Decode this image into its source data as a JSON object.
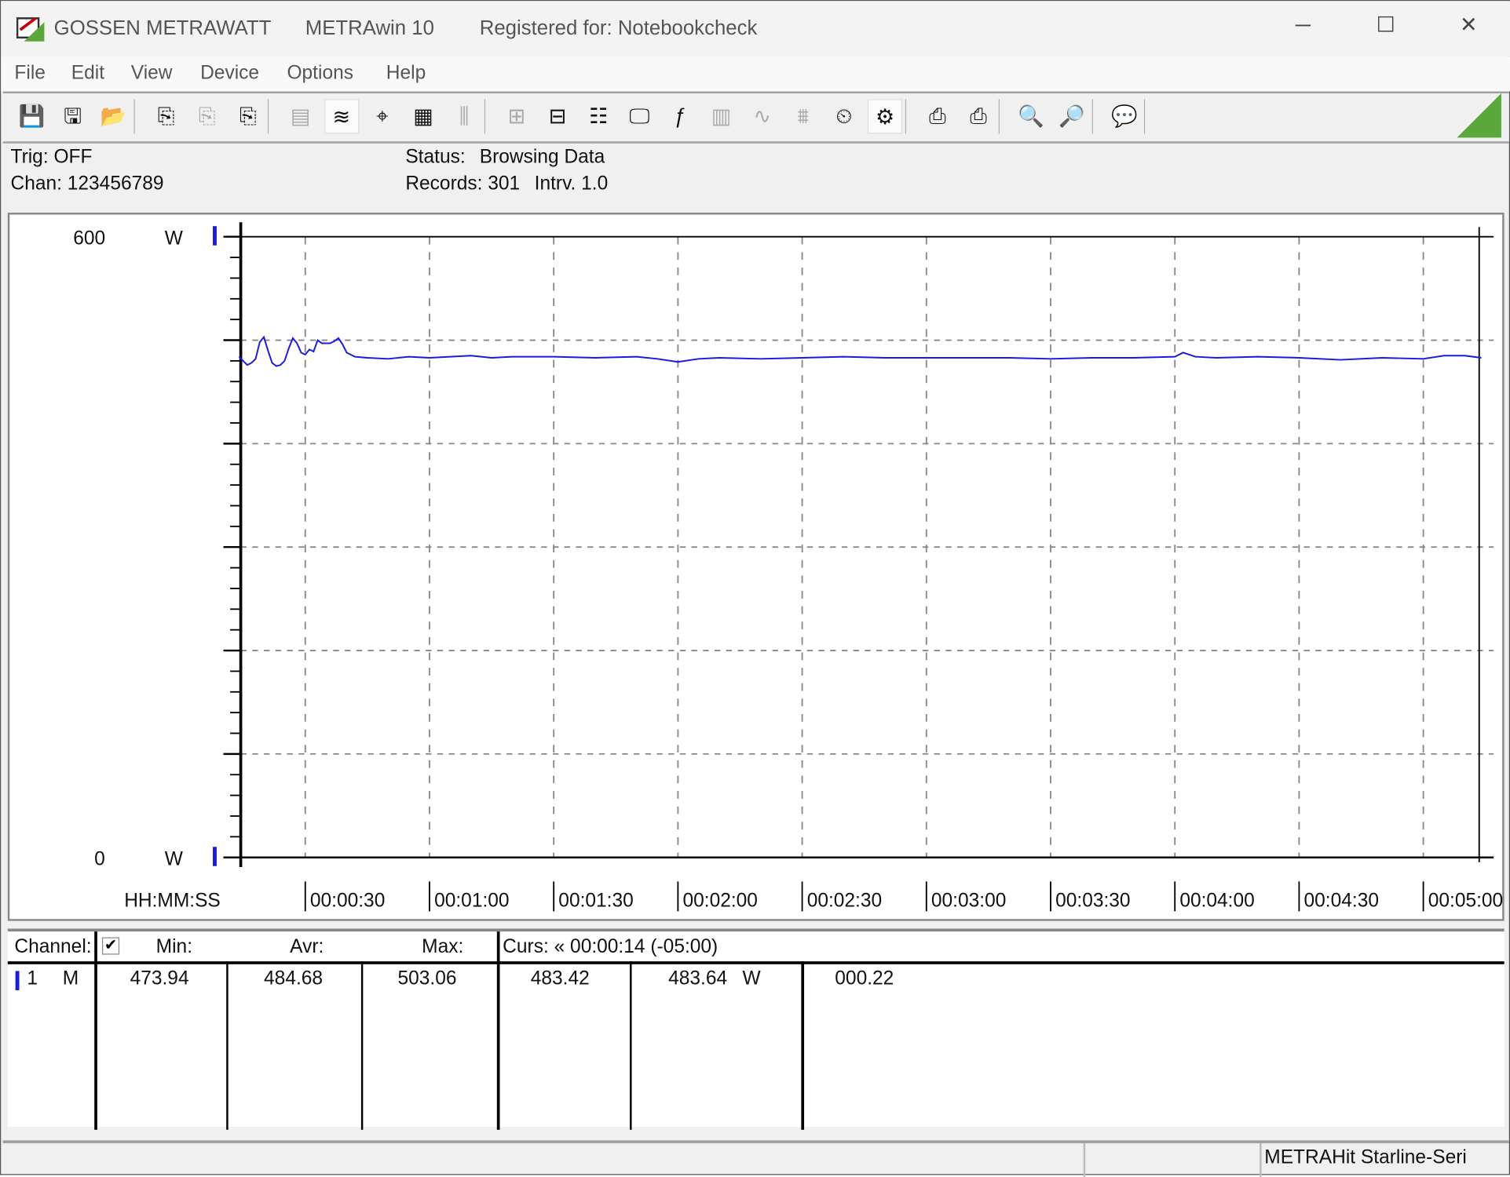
{
  "titlebar": {
    "vendor": "GOSSEN METRAWATT",
    "app": "METRAwin 10",
    "registered": "Registered for: Notebookcheck",
    "minimize": "─",
    "maximize": "☐",
    "close": "✕"
  },
  "menu": [
    "File",
    "Edit",
    "View",
    "Device",
    "Options",
    "Help"
  ],
  "toolbar": [
    {
      "name": "save-icon",
      "glyph": "💾"
    },
    {
      "name": "save-as-icon",
      "glyph": "🖫"
    },
    {
      "name": "open-folder-icon",
      "glyph": "📂"
    },
    {
      "name": "device-read-icon",
      "glyph": "⎘"
    },
    {
      "name": "device-settings-icon",
      "glyph": "⎘",
      "disabled": true
    },
    {
      "name": "device-memory-icon",
      "glyph": "⎘"
    },
    {
      "name": "display-icon",
      "glyph": "▤",
      "disabled": true
    },
    {
      "name": "waveform-view-icon",
      "glyph": "≋",
      "active": true
    },
    {
      "name": "crosshair-icon",
      "glyph": "⌖"
    },
    {
      "name": "table-view-icon",
      "glyph": "▦"
    },
    {
      "name": "bar-view-icon",
      "glyph": "⫼",
      "disabled": true
    },
    {
      "name": "channel-config-icon",
      "glyph": "⊞",
      "disabled": true
    },
    {
      "name": "channel-select-icon",
      "glyph": "⊟"
    },
    {
      "name": "list-config-icon",
      "glyph": "☷"
    },
    {
      "name": "monitor-icon",
      "glyph": "🖵"
    },
    {
      "name": "function-icon",
      "glyph": "ƒ"
    },
    {
      "name": "report-icon",
      "glyph": "▥",
      "disabled": true
    },
    {
      "name": "signal-icon",
      "glyph": "∿",
      "disabled": true
    },
    {
      "name": "samples-icon",
      "glyph": "⩩",
      "disabled": true
    },
    {
      "name": "timer-icon",
      "glyph": "⏲"
    },
    {
      "name": "trigger-icon",
      "glyph": "⚙",
      "active": true
    },
    {
      "name": "print-icon",
      "glyph": "⎙"
    },
    {
      "name": "print-preview-icon",
      "glyph": "⎙"
    },
    {
      "name": "zoom-in-icon",
      "glyph": "🔍"
    },
    {
      "name": "zoom-out-icon",
      "glyph": "🔎"
    },
    {
      "name": "help-icon",
      "glyph": "💬"
    }
  ],
  "info": {
    "trig": "Trig: OFF",
    "chan": "Chan:  123456789",
    "status_label": "Status:",
    "status_value": "Browsing Data",
    "records": "Records: 301",
    "interval": "Intrv. 1.0"
  },
  "colors": {
    "series": "#1a1ae6",
    "accent_green": "#5aa83a"
  },
  "chart_data": {
    "type": "line",
    "ylim": [
      0,
      600
    ],
    "y_top_label": "600",
    "y_bottom_label": "0",
    "y_unit": "W",
    "xlabel": "HH:MM:SS",
    "xlim_seconds": [
      14,
      314
    ],
    "x_ticks": [
      "00:00:30",
      "00:01:00",
      "00:01:30",
      "00:02:00",
      "00:02:30",
      "00:03:00",
      "00:03:30",
      "00:04:00",
      "00:04:30",
      "00:05:00"
    ],
    "x_tick_seconds": [
      30,
      60,
      90,
      120,
      150,
      180,
      210,
      240,
      270,
      300
    ],
    "y_grid": [
      100,
      200,
      300,
      400,
      500
    ],
    "grid": true,
    "series": [
      {
        "x": [
          14,
          15,
          16,
          17,
          18,
          19,
          20,
          21,
          22,
          23,
          24,
          25,
          26,
          27,
          28,
          29,
          30,
          31,
          32,
          33,
          34,
          35,
          36,
          37,
          38,
          39,
          40,
          42,
          45,
          50,
          55,
          60,
          65,
          70,
          75,
          80,
          90,
          100,
          110,
          115,
          120,
          125,
          130,
          140,
          150,
          160,
          170,
          180,
          190,
          200,
          210,
          220,
          230,
          240,
          242,
          245,
          250,
          260,
          270,
          280,
          290,
          300,
          305,
          310,
          314
        ],
        "y": [
          484,
          480,
          476,
          478,
          482,
          498,
          503,
          490,
          478,
          475,
          476,
          480,
          492,
          502,
          497,
          488,
          486,
          491,
          489,
          500,
          497,
          497,
          497,
          499,
          502,
          496,
          488,
          484,
          483,
          482,
          484,
          483,
          484,
          485,
          483,
          484,
          484,
          483,
          484,
          482,
          479,
          482,
          483,
          482,
          483,
          484,
          483,
          483,
          483,
          483,
          482,
          483,
          483,
          484,
          488,
          484,
          483,
          484,
          483,
          481,
          483,
          482,
          485,
          485,
          483
        ]
      }
    ]
  },
  "table": {
    "headers": {
      "channel": "Channel:",
      "min": "Min:",
      "avr": "Avr:",
      "max": "Max:",
      "cursor": "Curs: « 00:00:14 (-05:00)"
    },
    "row": {
      "num": "1",
      "mode": "M",
      "min": "473.94",
      "avr": "484.68",
      "max": "503.06",
      "curs1": "483.42",
      "curs2": "483.64",
      "unit": "W",
      "diff": "000.22"
    }
  },
  "statusbar": {
    "device": "METRAHit Starline-Seri"
  }
}
